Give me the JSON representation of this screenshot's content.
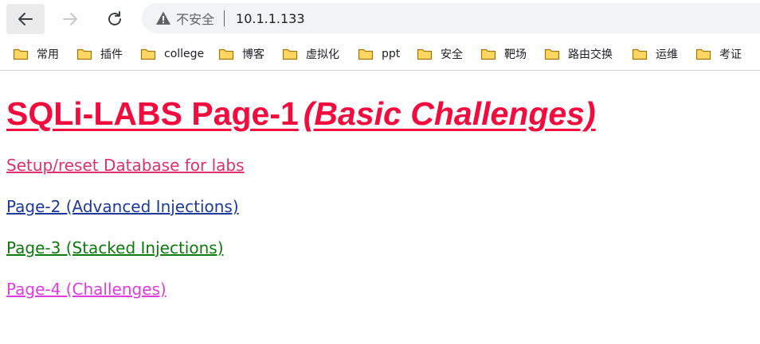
{
  "browser": {
    "security_label": "不安全",
    "url": "10.1.1.133",
    "icons": {
      "back": "back-arrow-icon",
      "forward": "forward-arrow-icon",
      "reload": "reload-icon",
      "warning": "warning-icon"
    }
  },
  "bookmarks": [
    {
      "label": "常用"
    },
    {
      "label": "插件"
    },
    {
      "label": "college"
    },
    {
      "label": "博客"
    },
    {
      "label": "虚拟化"
    },
    {
      "label": "ppt"
    },
    {
      "label": "安全"
    },
    {
      "label": "靶场"
    },
    {
      "label": "路由交换"
    },
    {
      "label": "运维"
    },
    {
      "label": "考证"
    }
  ],
  "page": {
    "title": "SQLi-LABS Page-1",
    "subtitle": "(Basic Challenges)",
    "links": {
      "setup": "Setup/reset Database for labs",
      "page2": "Page-2 (Advanced Injections)",
      "page3": "Page-3 (Stacked Injections)",
      "page4": "Page-4 (Challenges)"
    },
    "colors": {
      "title": "#f50a3e",
      "setup": "#e0306e",
      "page2": "#1e3a9a",
      "page3": "#0d7a0d",
      "page4": "#e03de0"
    }
  }
}
